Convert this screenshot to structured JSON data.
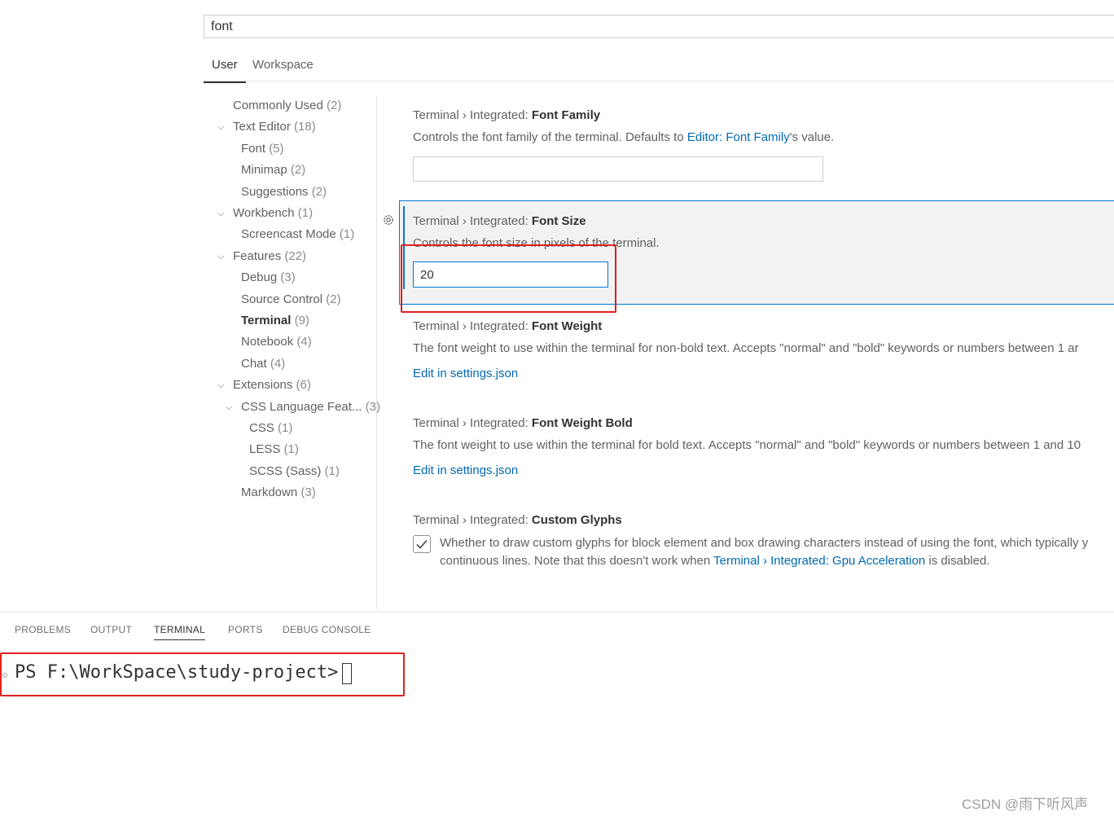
{
  "search": {
    "value": "font"
  },
  "scope_tabs": [
    {
      "label": "User"
    },
    {
      "label": "Workspace"
    }
  ],
  "toc": [
    {
      "label": "Commonly Used",
      "count": "(2)"
    },
    {
      "label": "Text Editor",
      "count": "(18)"
    },
    {
      "label": "Font",
      "count": "(5)"
    },
    {
      "label": "Minimap",
      "count": "(2)"
    },
    {
      "label": "Suggestions",
      "count": "(2)"
    },
    {
      "label": "Workbench",
      "count": "(1)"
    },
    {
      "label": "Screencast Mode",
      "count": "(1)"
    },
    {
      "label": "Features",
      "count": "(22)"
    },
    {
      "label": "Debug",
      "count": "(3)"
    },
    {
      "label": "Source Control",
      "count": "(2)"
    },
    {
      "label": "Terminal",
      "count": "(9)"
    },
    {
      "label": "Notebook",
      "count": "(4)"
    },
    {
      "label": "Chat",
      "count": "(4)"
    },
    {
      "label": "Extensions",
      "count": "(6)"
    },
    {
      "label": "CSS Language Feat...",
      "count": "(3)"
    },
    {
      "label": "CSS",
      "count": "(1)"
    },
    {
      "label": "LESS",
      "count": "(1)"
    },
    {
      "label": "SCSS (Sass)",
      "count": "(1)"
    },
    {
      "label": "Markdown",
      "count": "(3)"
    }
  ],
  "settings": {
    "font_family": {
      "category": "Terminal › Integrated: ",
      "name": "Font Family",
      "desc_before": "Controls the font family of the terminal. Defaults to ",
      "desc_link": "Editor: Font Family",
      "desc_after": "'s value.",
      "value": ""
    },
    "font_size": {
      "category": "Terminal › Integrated: ",
      "name": "Font Size",
      "desc": "Controls the font size in pixels of the terminal.",
      "value": "20"
    },
    "font_weight": {
      "category": "Terminal › Integrated: ",
      "name": "Font Weight",
      "desc": "The font weight to use within the terminal for non-bold text. Accepts \"normal\" and \"bold\" keywords or numbers between 1 ar",
      "link": "Edit in settings.json"
    },
    "font_weight_bold": {
      "category": "Terminal › Integrated: ",
      "name": "Font Weight Bold",
      "desc": "The font weight to use within the terminal for bold text. Accepts \"normal\" and \"bold\" keywords or numbers between 1 and 10",
      "link": "Edit in settings.json"
    },
    "custom_glyphs": {
      "category": "Terminal › Integrated: ",
      "name": "Custom Glyphs",
      "desc_line1": "Whether to draw custom glyphs for block element and box drawing characters instead of using the font, which typically y",
      "desc_line2_before": "continuous lines. Note that this doesn't work when ",
      "desc_link": "Terminal › Integrated: Gpu Acceleration",
      "desc_line2_after": " is disabled.",
      "checked": true
    }
  },
  "panel_tabs": [
    {
      "label": "PROBLEMS"
    },
    {
      "label": "OUTPUT"
    },
    {
      "label": "TERMINAL"
    },
    {
      "label": "PORTS"
    },
    {
      "label": "DEBUG CONSOLE"
    }
  ],
  "terminal": {
    "prompt": "PS F:\\WorkSpace\\study-project> "
  },
  "watermark": "CSDN @雨下听风声",
  "colors": {
    "focus_border": "#0078d4",
    "link": "#006ab1",
    "annotation_red": "#e0201e"
  }
}
